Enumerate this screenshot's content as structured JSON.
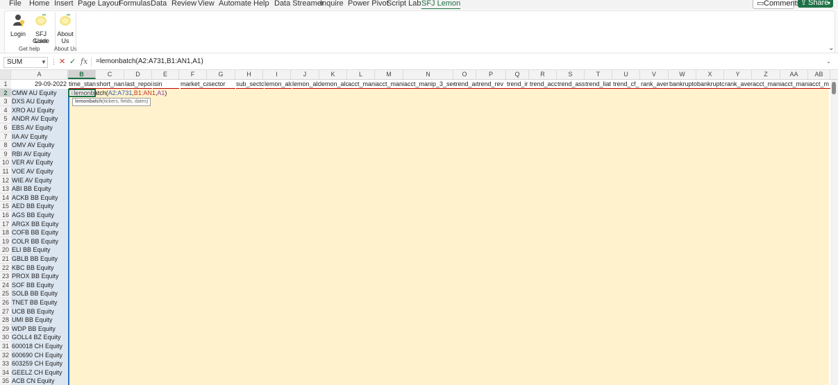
{
  "ribbon_tabs": [
    "File",
    "Home",
    "Insert",
    "Page Layout",
    "Formulas",
    "Data",
    "Review",
    "View",
    "Automate",
    "Help",
    "Data Streamer",
    "Inquire",
    "Power Pivot",
    "Script Lab",
    "SFJ Lemon"
  ],
  "active_tab": "SFJ Lemon",
  "comments_label": "Comments",
  "share_label": "Share",
  "ribbon": {
    "login_label": "Login",
    "guide_label_1": "SFJ User",
    "guide_label_2": "Guide",
    "about_label_1": "About",
    "about_label_2": "Us",
    "group_help": "Get help",
    "group_about": "About Us"
  },
  "name_box": "SUM",
  "fx_label": "fx",
  "formula_text": "=lemonbatch(A2:A731,B1:AN1,A1)",
  "cell_edit": {
    "prefix": "=lemonbatch(",
    "arg1": "A2:A731",
    "arg2": "B1:AN1",
    "arg3": "A1",
    "suffix": ")"
  },
  "tooltip": {
    "fn": "lemonbatch",
    "args": "(tickers, fields, dates)"
  },
  "columns": [
    "A",
    "B",
    "C",
    "D",
    "E",
    "F",
    "G",
    "H",
    "I",
    "J",
    "K",
    "L",
    "M",
    "N",
    "O",
    "P",
    "Q",
    "R",
    "S",
    "T",
    "U",
    "V",
    "W",
    "X",
    "Y",
    "Z",
    "AA",
    "AB"
  ],
  "row_numbers": [
    "1",
    "2",
    "3",
    "4",
    "5",
    "6",
    "7",
    "8",
    "9",
    "10",
    "11",
    "12",
    "13",
    "14",
    "15",
    "16",
    "17",
    "18",
    "19",
    "20",
    "21",
    "22",
    "23",
    "24",
    "25",
    "26",
    "27",
    "28",
    "29",
    "30",
    "31",
    "32",
    "33",
    "34",
    "35"
  ],
  "row1": {
    "A": "29-09-2022",
    "B": "time_stan",
    "C": "short_nan",
    "D": "last_repoi",
    "E": "isin",
    "F": "market_ca",
    "G": "sector",
    "H": "sub_secto",
    "I": "lemon_alc",
    "J": "lemon_alc",
    "K": "lemon_alc",
    "L": "acct_mani",
    "M": "acct_mani",
    "N": "acct_manip_3_sec",
    "O": "trend_ac",
    "P": "trend_rev",
    "Q": "trend_ir",
    "R": "trend_acc",
    "S": "trend_ass",
    "T": "trend_liat",
    "U": "trend_cf_",
    "V": "rank_aver",
    "W": "bankrupto",
    "X": "bankruptc",
    "Y": "rank_aver",
    "Z": "acct_mani",
    "AA": "acct_mani",
    "AB": "acct_m"
  },
  "tickers": [
    "CMW AU Equity",
    "DXS AU Equity",
    "XRO AU Equity",
    "ANDR AV Equity",
    "EBS AV Equity",
    "IIA AV Equity",
    "OMV AV Equity",
    "RBI AV Equity",
    "VER AV Equity",
    "VOE AV Equity",
    "WIE AV Equity",
    "ABI BB Equity",
    "ACKB BB Equity",
    "AED BB Equity",
    "AGS BB Equity",
    "ARGX BB Equity",
    "COFB BB Equity",
    "COLR BB Equity",
    "ELI BB Equity",
    "GBLB BB Equity",
    "KBC BB Equity",
    "PROX BB Equity",
    "SOF BB Equity",
    "SOLB BB Equity",
    "TNET BB Equity",
    "UCB BB Equity",
    "UMI BB Equity",
    "WDP BB Equity",
    "GOLL4 BZ Equity",
    "600018 CH Equity",
    "600690 CH Equity",
    "603259 CH Equity",
    "GEELZ CH Equity",
    "ACB CN Equity"
  ]
}
